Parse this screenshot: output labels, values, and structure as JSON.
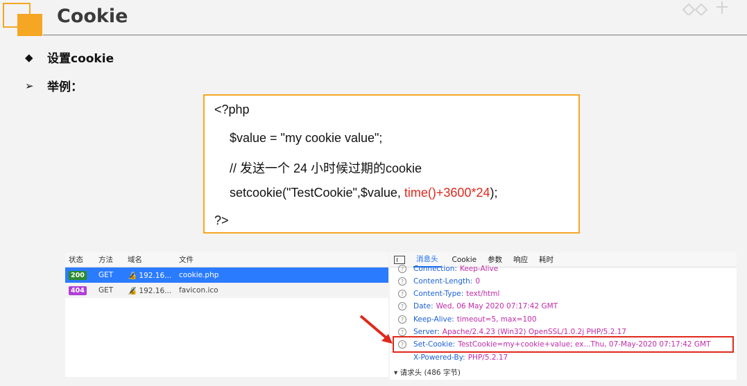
{
  "header": {
    "title": "Cookie"
  },
  "bullets": [
    {
      "icon": "◆",
      "text": "设置cookie"
    },
    {
      "icon": "➢",
      "text": "举例："
    }
  ],
  "code": {
    "open": "<?php",
    "line1": "$value = \"my cookie value\";",
    "comment": "// 发送一个 24 小时候过期的cookie",
    "call_prefix": "setcookie(\"TestCookie\",$value, ",
    "call_highlight": "time()+3600*24",
    "call_suffix": ");",
    "close": "?>"
  },
  "network": {
    "columns": [
      "状态",
      "方法",
      "域名",
      "文件"
    ],
    "rows": [
      {
        "status": "200",
        "method": "GET",
        "domain": "192.16...",
        "file": "cookie.php"
      },
      {
        "status": "404",
        "method": "GET",
        "domain": "192.16...",
        "file": "favicon.ico"
      }
    ]
  },
  "panel": {
    "tabs": [
      "消息头",
      "Cookie",
      "参数",
      "响应",
      "耗时"
    ],
    "headers": [
      {
        "key": "Connection:",
        "value": "Keep-Alive"
      },
      {
        "key": "Content-Length:",
        "value": "0"
      },
      {
        "key": "Content-Type:",
        "value": "text/html"
      },
      {
        "key": "Date:",
        "value": "Wed, 06 May 2020 07:17:42 GMT"
      },
      {
        "key": "Keep-Alive:",
        "value": "timeout=5, max=100"
      },
      {
        "key": "Server:",
        "value": "Apache/2.4.23 (Win32) OpenSSL/1.0.2j PHP/5.2.17"
      },
      {
        "key": "Set-Cookie:",
        "value": "TestCookie=my+cookie+value; ex...Thu, 07-May-2020 07:17:42 GMT"
      },
      {
        "key": "X-Powered-By:",
        "value": "PHP/5.2.17"
      }
    ],
    "request_section": "▾ 请求头 (486 字节)"
  },
  "colors": {
    "accent": "#f5a623",
    "highlight_red": "#e0281c",
    "selected_blue": "#2b7bff"
  }
}
